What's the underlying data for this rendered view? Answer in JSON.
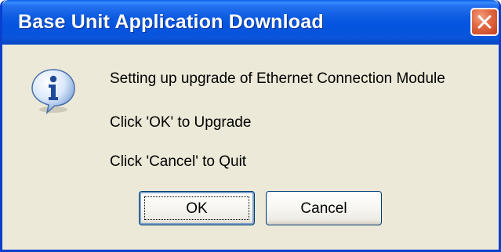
{
  "dialog": {
    "title": "Base Unit Application Download",
    "icon": "info-icon",
    "messages": [
      "Setting up upgrade of Ethernet Connection Module",
      "Click 'OK' to Upgrade",
      "Click 'Cancel' to Quit"
    ],
    "buttons": {
      "ok": "OK",
      "cancel": "Cancel"
    },
    "colors": {
      "titlebar": "#0454e0",
      "body": "#ece9d8",
      "close_button": "#e36a44"
    }
  }
}
